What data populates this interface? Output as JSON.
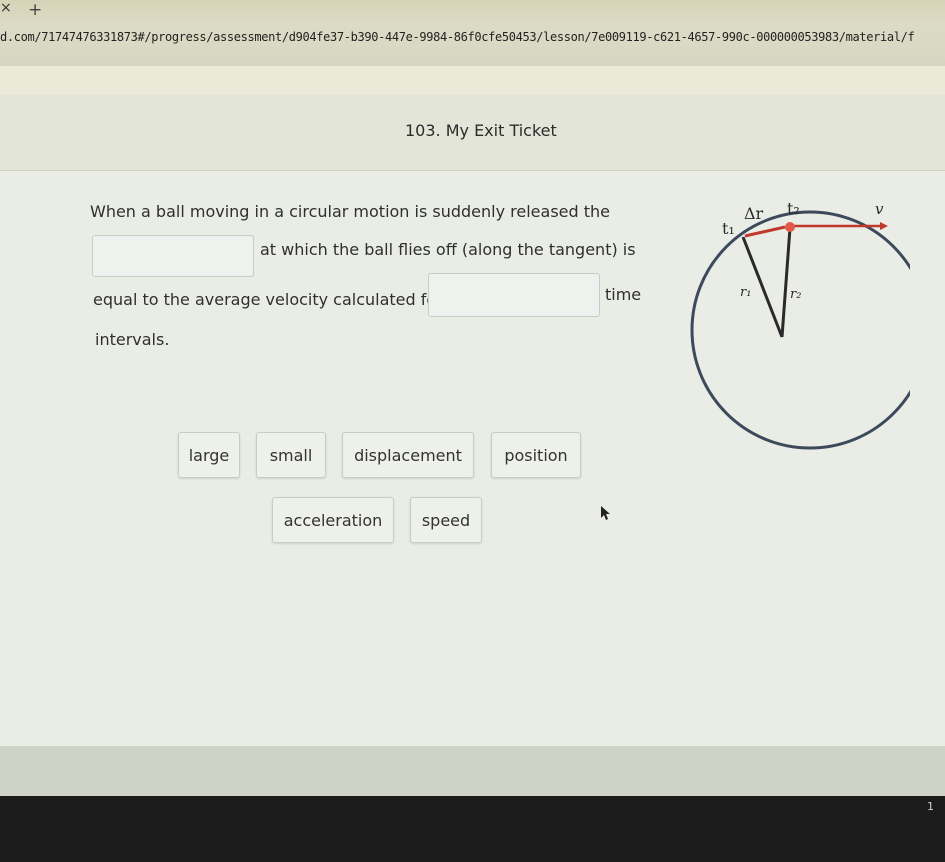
{
  "browser": {
    "new_tab_glyph": "+",
    "close_tab_glyph": "×",
    "url": "d.com/71747476331873#/progress/assessment/d904fe37-b390-447e-9984-86f0cfe50453/lesson/7e009119-c621-4657-990c-000000053983/material/f"
  },
  "page": {
    "title": "103. My Exit Ticket",
    "page_number": "1"
  },
  "question": {
    "line1": "When a ball moving in a circular motion is suddenly released the",
    "line2": "at which the ball flies off (along the tangent) is",
    "line3_start": "equal to the average velocity calculated for",
    "line3_end": "time",
    "line4": "intervals."
  },
  "choices": [
    "large",
    "small",
    "displacement",
    "position",
    "acceleration",
    "speed"
  ],
  "diagram": {
    "t1": "t₁",
    "t2": "t₂",
    "delta_r": "Δr",
    "v": "v",
    "r1": "r₁",
    "r2": "r₂",
    "colors": {
      "vector_arrow": "#c0392b",
      "circle": "#3d4a5c",
      "point": "#e05a4a"
    }
  }
}
